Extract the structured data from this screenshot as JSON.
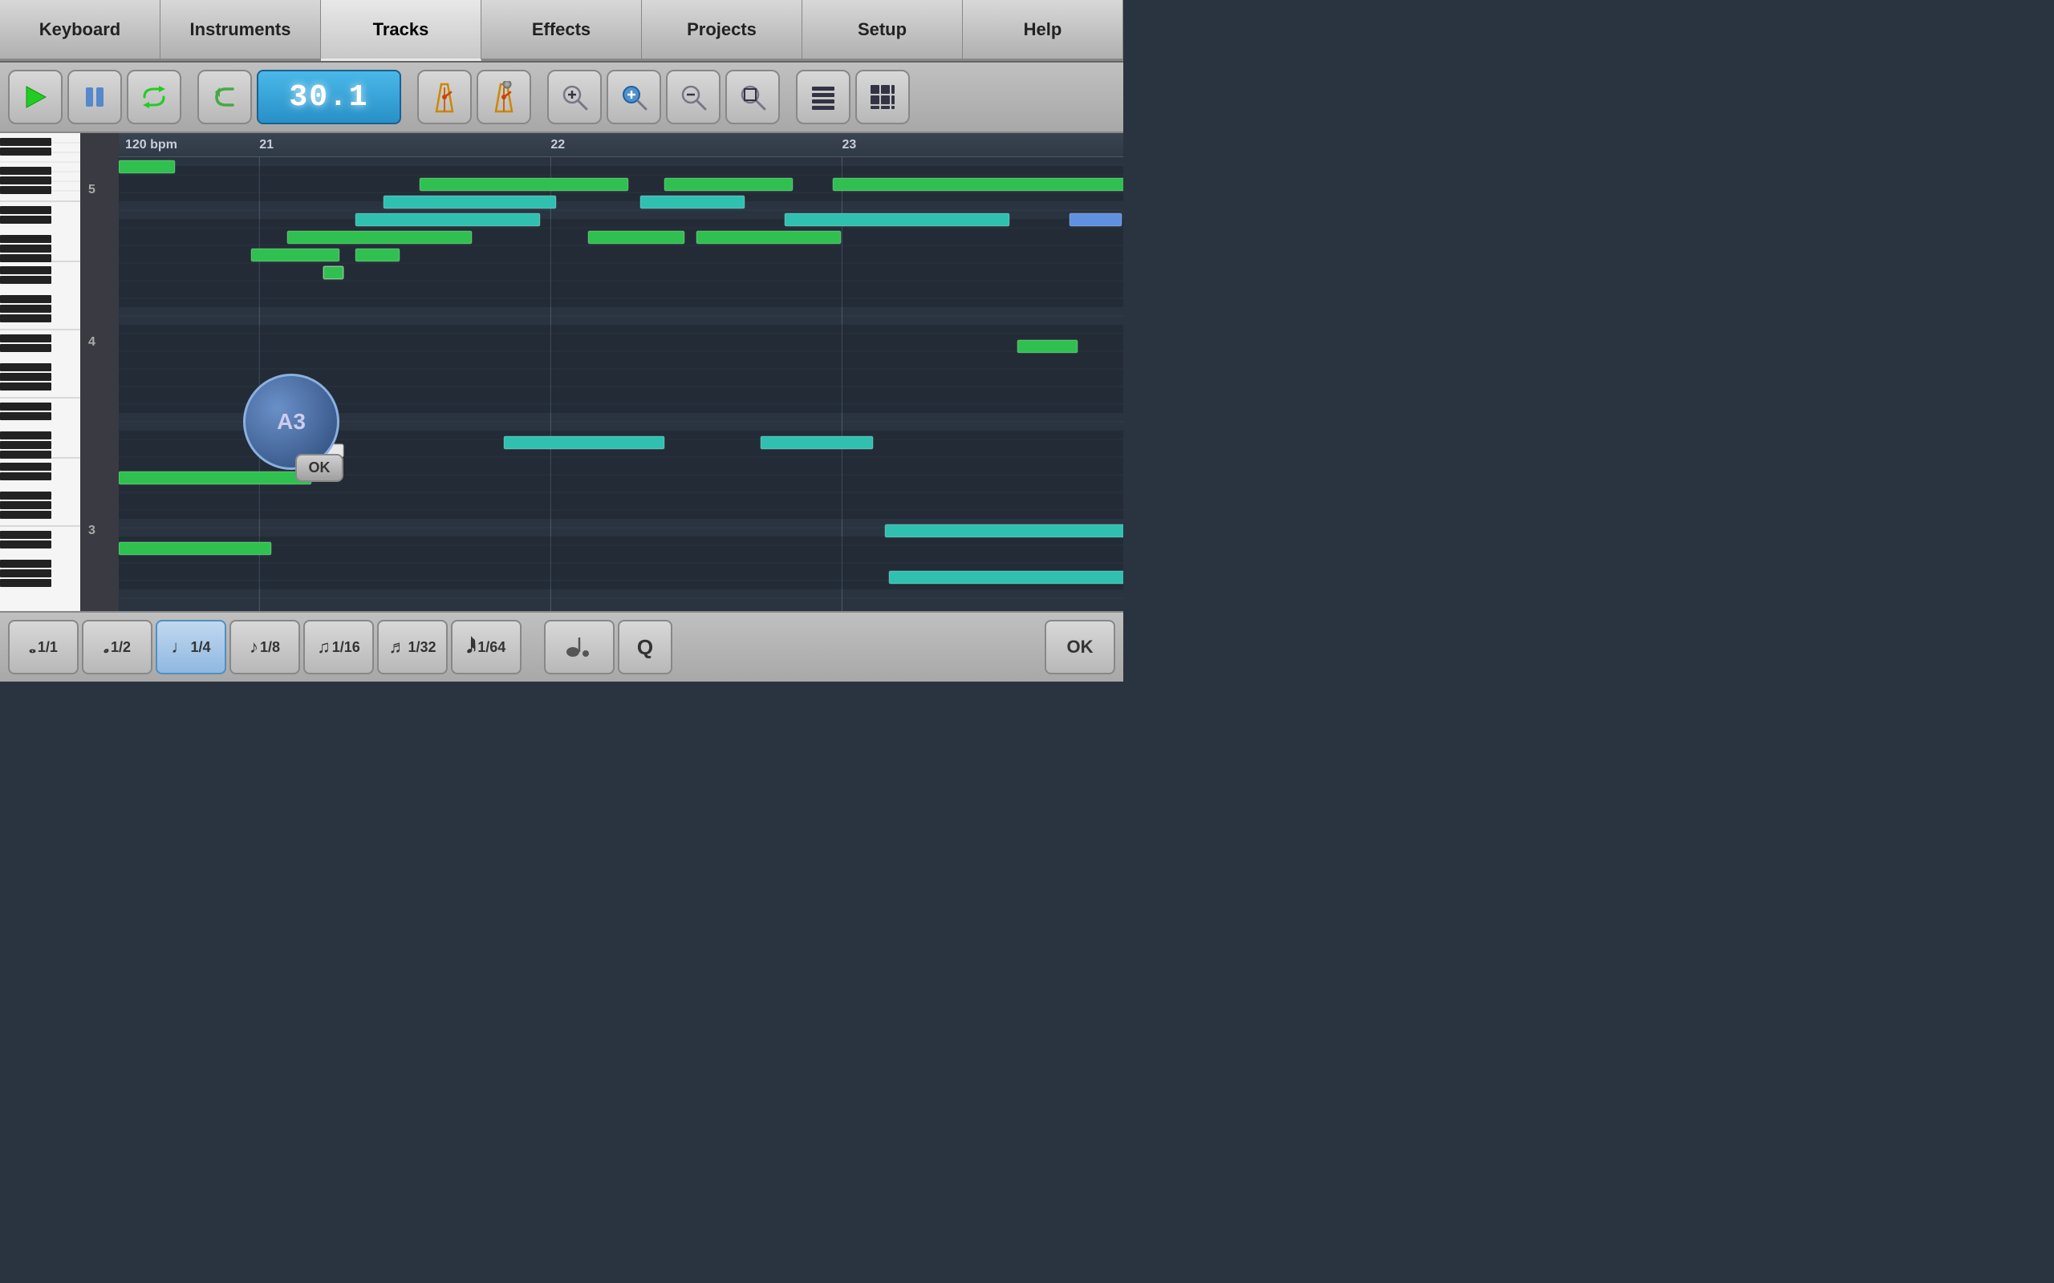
{
  "nav": {
    "tabs": [
      {
        "id": "keyboard",
        "label": "Keyboard",
        "active": false
      },
      {
        "id": "instruments",
        "label": "Instruments",
        "active": false
      },
      {
        "id": "tracks",
        "label": "Tracks",
        "active": true
      },
      {
        "id": "effects",
        "label": "Effects",
        "active": false
      },
      {
        "id": "projects",
        "label": "Projects",
        "active": false
      },
      {
        "id": "setup",
        "label": "Setup",
        "active": false
      },
      {
        "id": "help",
        "label": "Help",
        "active": false
      }
    ]
  },
  "toolbar": {
    "time_display": "30.1",
    "bpm": "120 bpm"
  },
  "ruler": {
    "markers": [
      {
        "label": "21",
        "position_pct": 15
      },
      {
        "label": "22",
        "position_pct": 44
      },
      {
        "label": "23",
        "position_pct": 73
      }
    ]
  },
  "popup": {
    "note_label": "A3",
    "ok_label": "OK"
  },
  "bottom_toolbar": {
    "note_buttons": [
      {
        "id": "whole",
        "symbol": "𝅝",
        "frac": "1/1",
        "active": false
      },
      {
        "id": "half",
        "symbol": "𝅗𝅥",
        "frac": "1/2",
        "active": false
      },
      {
        "id": "quarter",
        "symbol": "♩",
        "frac": "1/4",
        "active": true
      },
      {
        "id": "eighth",
        "symbol": "♪",
        "frac": "1/8",
        "active": false
      },
      {
        "id": "sixteenth",
        "symbol": "♫",
        "frac": "1/16",
        "active": false
      },
      {
        "id": "thirty_second",
        "symbol": "♬",
        "frac": "1/32",
        "active": false
      },
      {
        "id": "sixty_fourth",
        "symbol": "𝅘𝅥𝅱",
        "frac": "1/64",
        "active": false
      }
    ],
    "dot_label": "·",
    "q_label": "Q",
    "ok_label": "OK"
  }
}
